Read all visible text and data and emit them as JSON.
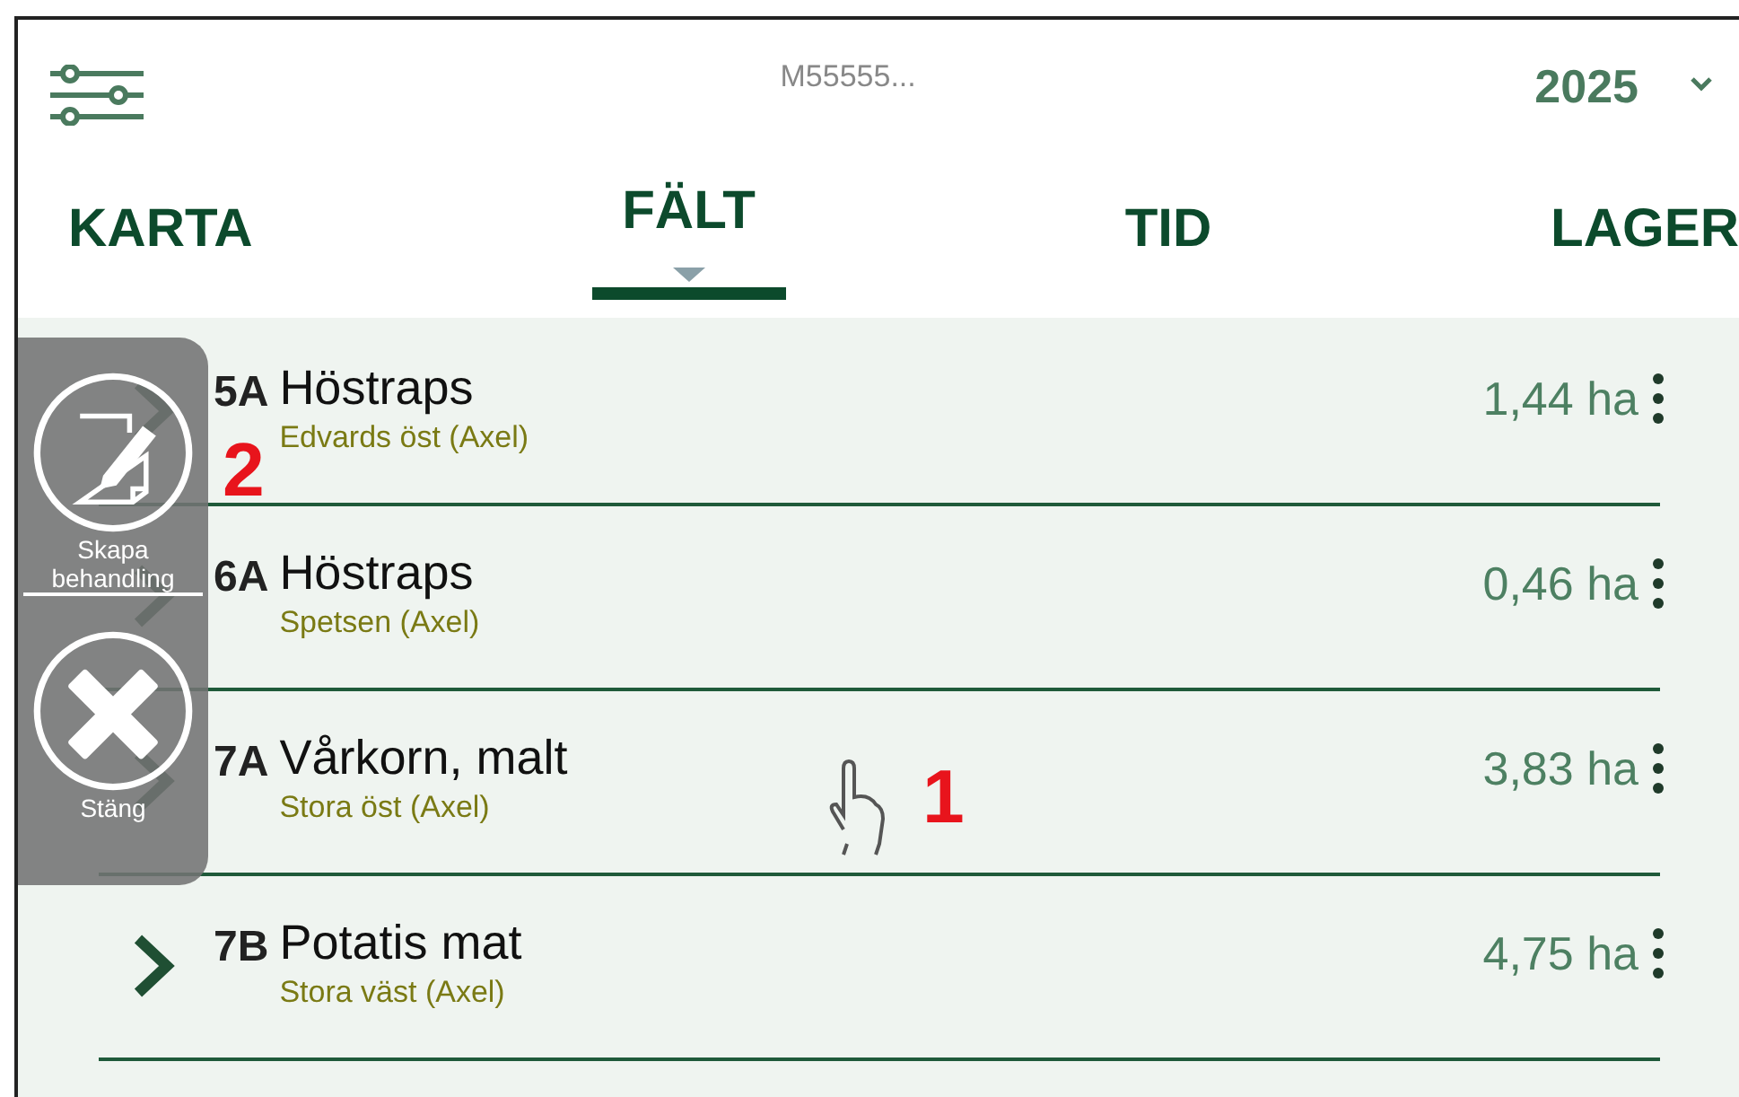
{
  "header": {
    "title": "M55555...",
    "year": "2025"
  },
  "tabs": [
    {
      "label": "KARTA",
      "selected": false
    },
    {
      "label": "FÄLT",
      "selected": true
    },
    {
      "label": "TID",
      "selected": false
    },
    {
      "label": "LAGER",
      "selected": false
    }
  ],
  "fields": [
    {
      "code": "5A",
      "crop": "Höstraps",
      "location": "Edvards öst (Axel)",
      "area": "1,44 ha"
    },
    {
      "code": "6A",
      "crop": "Höstraps",
      "location": "Spetsen (Axel)",
      "area": "0,46 ha"
    },
    {
      "code": "7A",
      "crop": "Vårkorn, malt",
      "location": "Stora öst (Axel)",
      "area": "3,83 ha"
    },
    {
      "code": "7B",
      "crop": "Potatis mat",
      "location": "Stora väst (Axel)",
      "area": "4,75 ha"
    }
  ],
  "actions": [
    {
      "kind": "edit",
      "label": "Skapa behandling",
      "focused": true
    },
    {
      "kind": "close",
      "label": "Stäng",
      "focused": false
    }
  ],
  "annotations": [
    "1",
    "2"
  ]
}
